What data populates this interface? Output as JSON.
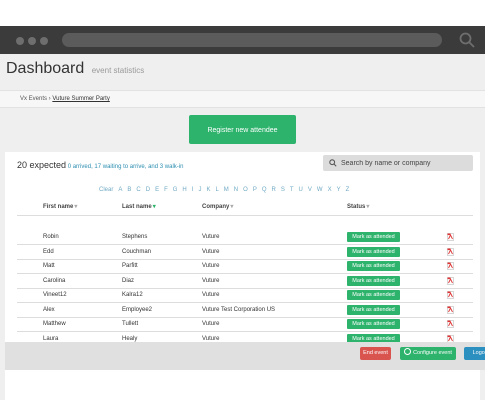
{
  "header": {
    "title": "Dashboard",
    "subtitle": "event statistics"
  },
  "breadcrumb": {
    "root": "Vx Events",
    "separator": " › ",
    "current": "Vuture Summer Party"
  },
  "register_button": "Register new attendee",
  "summary": {
    "count": "20 expected",
    "details": "0 arrived, 17 waiting to arrive, and 3 walk-in"
  },
  "search": {
    "placeholder": "Search by name or company",
    "icon": "search-icon"
  },
  "alphabet": [
    "Clear",
    "A",
    "B",
    "C",
    "D",
    "E",
    "F",
    "G",
    "H",
    "I",
    "J",
    "K",
    "L",
    "M",
    "N",
    "O",
    "P",
    "Q",
    "R",
    "S",
    "T",
    "U",
    "V",
    "W",
    "X",
    "Y",
    "Z"
  ],
  "table": {
    "columns": [
      {
        "label": "First name",
        "sort": "▾"
      },
      {
        "label": "Last name",
        "sort": "▾"
      },
      {
        "label": "Company",
        "sort": "▾"
      },
      {
        "label": "Status",
        "sort": "▾"
      }
    ],
    "rows": [
      {
        "first": "Robin",
        "last": "Stephens",
        "company": "Vuture",
        "status": "Mark as attended"
      },
      {
        "first": "Edd",
        "last": "Couchman",
        "company": "Vuture",
        "status": "Mark as attended"
      },
      {
        "first": "Matt",
        "last": "Parfitt",
        "company": "Vuture",
        "status": "Mark as attended"
      },
      {
        "first": "Carolina",
        "last": "Diaz",
        "company": "Vuture",
        "status": "Mark as attended"
      },
      {
        "first": "Vineet12",
        "last": "Kalra12",
        "company": "Vuture",
        "status": "Mark as attended"
      },
      {
        "first": "Alex",
        "last": "Employee2",
        "company": "Vuture Test Corporation US",
        "status": "Mark as attended"
      },
      {
        "first": "Matthew",
        "last": "Tullett",
        "company": "Vuture",
        "status": "Mark as attended"
      },
      {
        "first": "Laura",
        "last": "Healy",
        "company": "Vuture",
        "status": "Mark as attended"
      }
    ]
  },
  "footer": {
    "end_event": "End event",
    "configure_event": "Configure event",
    "logout": "Logout"
  },
  "colors": {
    "accent": "#2db36c",
    "danger": "#d9534f",
    "primary": "#2b8fc0",
    "link": "#6fa9c3"
  }
}
